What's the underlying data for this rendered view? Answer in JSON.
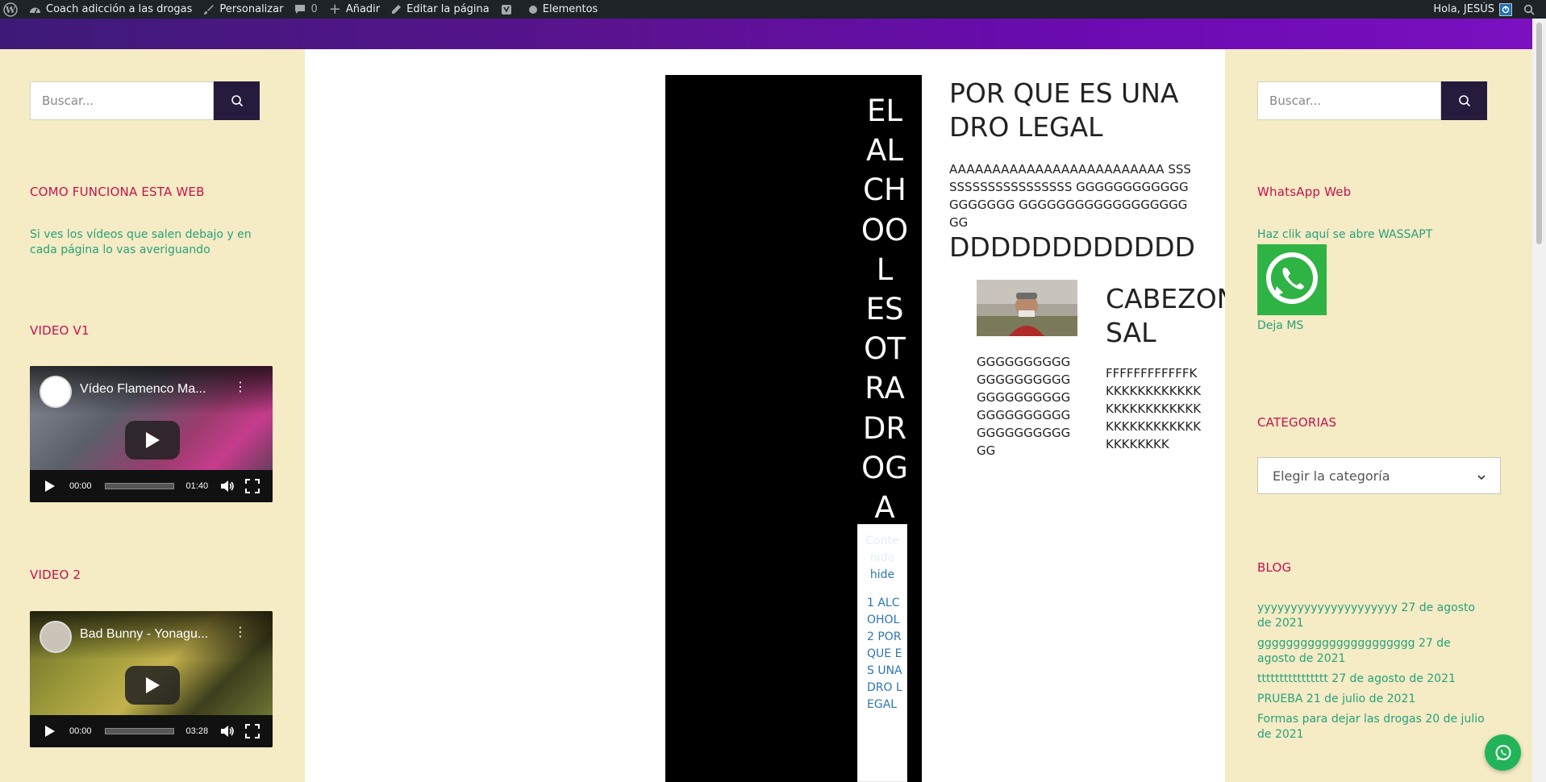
{
  "admin_bar": {
    "site_name": "Coach adicción a las drogas",
    "customize": "Personalizar",
    "comments_count": "0",
    "add_new": "Añadir",
    "edit_page": "Editar la página",
    "elements": "Elementos",
    "greeting": "Hola, JESÚS"
  },
  "left_sidebar": {
    "search_placeholder": "Buscar...",
    "widget1_title": "COMO FUNCIONA ESTA WEB",
    "widget1_text": "Si ves los vídeos que salen debajo y en cada página lo vas averiguando",
    "video1_title": "VIDEO V1",
    "video1": {
      "title": "Vídeo Flamenco Ma...",
      "current": "00:00",
      "duration": "01:40"
    },
    "video2_title": "VIDEO 2",
    "video2": {
      "title": "Bad Bunny - Yonagu...",
      "current": "00:00",
      "duration": "03:28"
    }
  },
  "content": {
    "vertical_title": "EL AL CH OO L ES OT RA DR OG A",
    "vertical_lines": [
      "EL",
      "AL",
      "CH",
      "OO",
      "L",
      "ES",
      "OT",
      "RA",
      "DR",
      "OG",
      "A"
    ],
    "toc_title": "Conte nido",
    "toc_hide": "hide",
    "toc_items": [
      "1 ALCOHOL",
      "2 POR QUE ES UNA DRO LEGAL"
    ],
    "heading1": "POR QUE ES UNA DRO LEGAL",
    "paragraph": "AAAAAAAAAAAAAAAAAAAAAAAAA SSSSSSSSSSSSSSSSSSS GGGGGGGGGGGGGGGGGGG GGGGGGGGGGGGGGGGGGGG",
    "big_text": "DDDDDDDDDDDD",
    "left_col_text": "GGGGGGGGGGGGGGGGGGGGGGGGGGGGGGGGGGGGGGGGGGGGGGGGGGGG",
    "heading2": "CABEZON SAL",
    "right_col_text": "FFFFFFFFFFFFKKKKKKKKKKKKKKKKKKKKKKKKKKKKKKKKKKKKKKKKKKKKK"
  },
  "right_sidebar": {
    "search_placeholder": "Buscar...",
    "whatsapp_title": "WhatsApp Web",
    "whatsapp_text": "Haz clik aquí se abre WASSAPT",
    "whatsapp_link": "Deja MS",
    "categories_title": "CATEGORIAS",
    "categories_select": "Elegir la categoría",
    "blog_title": "BLOG",
    "blog_entries": [
      {
        "title": "yyyyyyyyyyyyyyyyyyyyy",
        "date": "27 de agosto de 2021"
      },
      {
        "title": "gggggggggggggggggggggg",
        "date": "27 de agosto de 2021"
      },
      {
        "title": "tttttttttttttttt",
        "date": "27 de agosto de 2021"
      },
      {
        "title": "PRUEBA",
        "date": "21 de julio de 2021"
      },
      {
        "title": "Formas para dejar las drogas",
        "date": "20 de julio de 2021"
      }
    ]
  },
  "colors": {
    "admin_bar": "#1d2327",
    "sidebar_bg": "#f5ebc5",
    "widget_title": "#c4124d",
    "link": "#26a27a",
    "search_button": "#241b3d",
    "header_purple": "#5a138f"
  },
  "icons": [
    "wordpress-icon",
    "dashboard-icon",
    "brush-icon",
    "comment-icon",
    "plus-icon",
    "pencil-icon",
    "yoast-icon",
    "dot-icon",
    "search-icon",
    "whatsapp-icon"
  ]
}
